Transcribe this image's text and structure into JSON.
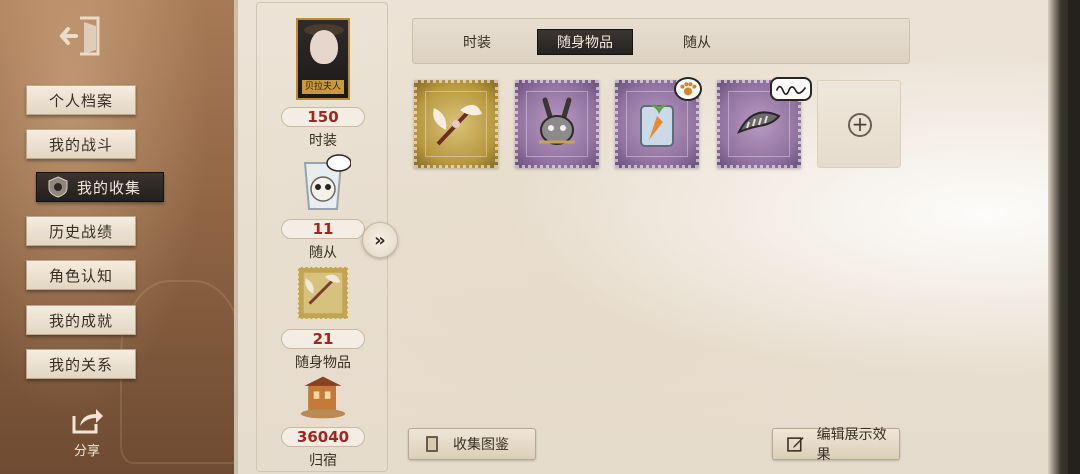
{
  "sidebar": {
    "exit_icon": "exit-door-icon",
    "items": [
      {
        "label": "个人档案",
        "active": false
      },
      {
        "label": "我的战斗",
        "active": false
      },
      {
        "label": "我的收集",
        "active": true
      },
      {
        "label": "历史战绩",
        "active": false
      },
      {
        "label": "角色认知",
        "active": false
      },
      {
        "label": "我的成就",
        "active": false
      },
      {
        "label": "我的关系",
        "active": false
      }
    ],
    "share_label": "分享",
    "share_icon": "share-icon"
  },
  "stats": [
    {
      "value": "150",
      "label": "时装",
      "thumb_text": "贝拉夫人",
      "icon": "costume-portrait"
    },
    {
      "value": "11",
      "label": "随从",
      "icon": "pet-jar-icon"
    },
    {
      "value": "21",
      "label": "随身物品",
      "icon": "accessory-stamp-icon"
    },
    {
      "value": "36040",
      "label": "归宿",
      "icon": "home-building-icon"
    }
  ],
  "expand_icon": "double-chevron-right-icon",
  "tabs": [
    {
      "label": "时装",
      "active": false
    },
    {
      "label": "随身物品",
      "active": true
    },
    {
      "label": "随从",
      "active": false
    }
  ],
  "items": [
    {
      "rarity": "gold",
      "icon": "winged-staff-icon"
    },
    {
      "rarity": "purple",
      "icon": "rabbit-mask-icon"
    },
    {
      "rarity": "purple",
      "icon": "carrot-jar-icon",
      "sticker": "paw-icon"
    },
    {
      "rarity": "purple",
      "icon": "fish-fossil-icon",
      "sticker": "signature-icon"
    },
    {
      "rarity": "empty",
      "icon": "plus-icon"
    }
  ],
  "bottom": {
    "catalog_label": "收集图鉴",
    "catalog_icon": "book-icon",
    "edit_label": "编辑展示效果",
    "edit_icon": "edit-icon"
  },
  "colors": {
    "count_red": "#a0271f",
    "active_dark": "#25221f",
    "gold_rarity": "#b8993f",
    "purple_rarity": "#9273a0"
  }
}
